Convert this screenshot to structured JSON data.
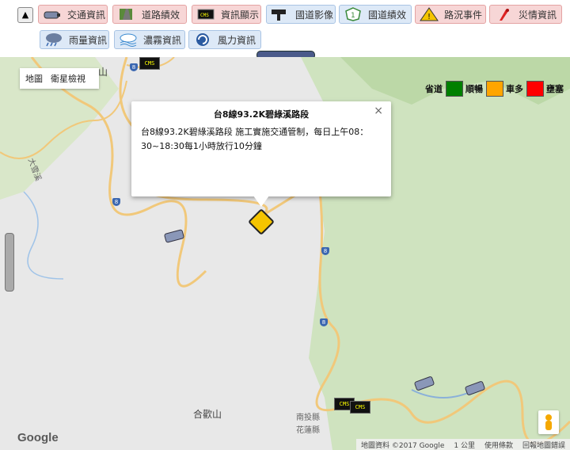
{
  "toolbar": {
    "up_icon": "arrow-up-icon",
    "row1": [
      {
        "label": "交通資訊",
        "color": "red",
        "icon": "camera-icon"
      },
      {
        "label": "道路績效",
        "color": "red",
        "icon": "road-icon"
      },
      {
        "label": "資訊顯示",
        "color": "red",
        "icon": "cms-icon"
      },
      {
        "label": "國道影像",
        "color": "blue",
        "icon": "highway-camera-icon"
      },
      {
        "label": "國道績效",
        "color": "blue",
        "icon": "highway-performance-icon"
      },
      {
        "label": "路況事件",
        "color": "red",
        "icon": "warning-icon"
      },
      {
        "label": "災情資訊",
        "color": "red",
        "icon": "disaster-icon"
      }
    ],
    "row2": [
      {
        "label": "雨量資訊",
        "color": "blue",
        "icon": "rain-icon"
      },
      {
        "label": "濃霧資訊",
        "color": "blue",
        "icon": "fog-icon"
      },
      {
        "label": "風力資訊",
        "color": "blue",
        "icon": "wind-icon"
      }
    ]
  },
  "map": {
    "maptype": [
      "地圖",
      "衛星檢視"
    ],
    "legend": {
      "title": "省道",
      "items": [
        {
          "label": "順暢",
          "color": "#008000"
        },
        {
          "label": "車多",
          "color": "#ffa500"
        },
        {
          "label": "壅塞",
          "color": "#ff0000"
        }
      ]
    },
    "popup": {
      "title": "台8線93.2K碧綠溪路段",
      "body_line1": "台8線93.2K碧綠溪路段 施工實施交通管制，每日上午08：",
      "body_line2": "30~18:30每1小時放行10分鐘",
      "close": "×"
    },
    "places": {
      "hehuan": "合歡山",
      "top_left": "山",
      "daxueshan": "大雪溪",
      "nantou": "南投縣",
      "hualien": "花蓮縣"
    },
    "route_number": "8",
    "cms_label": "CMS",
    "google": "Google",
    "footer": [
      "地圖資料 ©2017 Google",
      "1 公里",
      "使用條款",
      "回報地圖錯誤"
    ]
  }
}
